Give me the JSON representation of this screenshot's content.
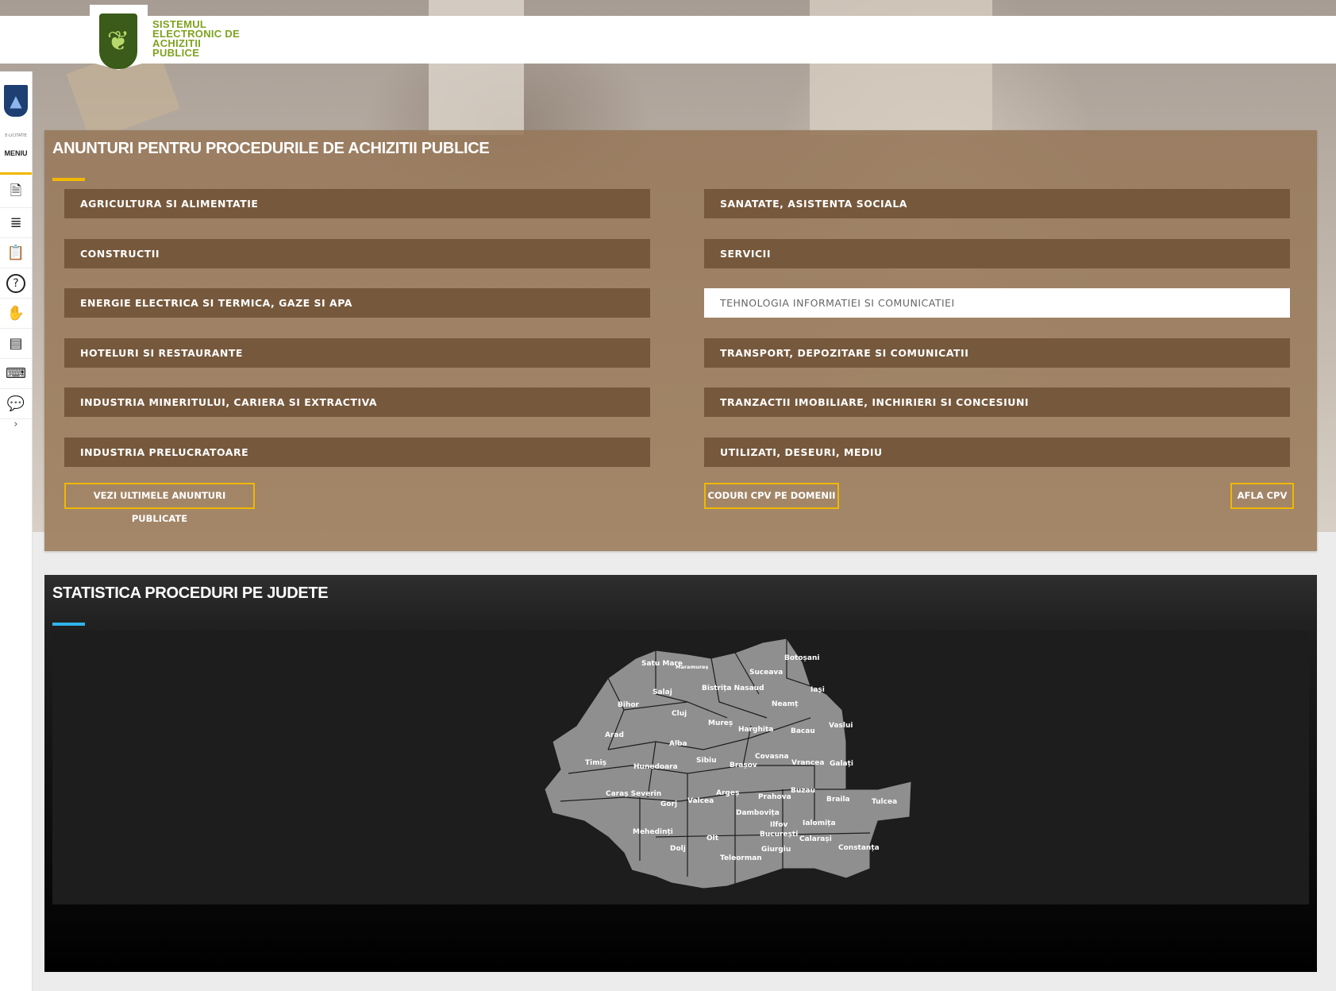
{
  "header": {
    "logo_lines": [
      "SISTEMUL",
      "ELECTRONIC DE",
      "ACHIZITII",
      "PUBLICE"
    ],
    "logo_icon": "wheat-shield-icon"
  },
  "sidebar": {
    "small_text": "E-LICITATIE",
    "menu_label": "MENIU",
    "items": [
      {
        "name": "document-icon",
        "glyph": "🗎"
      },
      {
        "name": "list-export-icon",
        "glyph": "≣"
      },
      {
        "name": "clipboard-check-icon",
        "glyph": "📋"
      },
      {
        "name": "help-icon",
        "glyph": "?"
      },
      {
        "name": "hand-money-icon",
        "glyph": "✋"
      },
      {
        "name": "contact-card-icon",
        "glyph": "▤"
      },
      {
        "name": "keyboard-icon",
        "glyph": "⌨"
      },
      {
        "name": "chat-icon",
        "glyph": "💬"
      }
    ],
    "expand_glyph": "›"
  },
  "announcements": {
    "title": "ANUNTURI PENTRU PROCEDURILE DE ACHIZITII PUBLICE",
    "categories_left": [
      "AGRICULTURA SI ALIMENTATIE",
      "CONSTRUCTII",
      "ENERGIE ELECTRICA SI TERMICA, GAZE SI APA",
      "HOTELURI SI RESTAURANTE",
      "INDUSTRIA MINERITULUI, CARIERA SI EXTRACTIVA",
      "INDUSTRIA PRELUCRATOARE"
    ],
    "categories_right": [
      "SANATATE, ASISTENTA SOCIALA",
      "SERVICII",
      "TEHNOLOGIA INFORMATIEI SI COMUNICATIEI",
      "TRANSPORT, DEPOZITARE SI COMUNICATII",
      "TRANZACTII IMOBILIARE, INCHIRIERI SI CONCESIUNI",
      "UTILIZATI, DESEURI, MEDIU"
    ],
    "active_category": "TEHNOLOGIA INFORMATIEI SI COMUNICATIEI",
    "btn_latest": "VEZI ULTIMELE ANUNTURI PUBLICATE",
    "btn_cpv_domains": "CODURI CPV PE DOMENII",
    "btn_find_cpv": "AFLA CPV"
  },
  "statistics": {
    "title": "STATISTICA PROCEDURI PE JUDETE",
    "counties": [
      "Satu Mare",
      "Maramureș",
      "Botoșani",
      "Suceava",
      "Salaj",
      "Bistrița Nasaud",
      "Iași",
      "Bihor",
      "Cluj",
      "Neamț",
      "Mureș",
      "Vaslui",
      "Harghita",
      "Bacau",
      "Arad",
      "Alba",
      "Covasna",
      "Timiș",
      "Hunedoara",
      "Sibiu",
      "Brașov",
      "Vrancea",
      "Galați",
      "Caraș Severin",
      "Gorj",
      "Valcea",
      "Argeș",
      "Buzau",
      "Prahova",
      "Braila",
      "Tulcea",
      "Dambovița",
      "Mehedinți",
      "Ilfov",
      "Ialomița",
      "Olt",
      "București",
      "Calarași",
      "Dolj",
      "Giurgiu",
      "Constanța",
      "Teleorman"
    ]
  },
  "colors": {
    "accent_gold": "#f0b800",
    "accent_blue": "#2fb4e9",
    "category_brown": "#76583c",
    "logo_green": "#7ea21f",
    "map_county_gray": "#8f8f8f"
  }
}
